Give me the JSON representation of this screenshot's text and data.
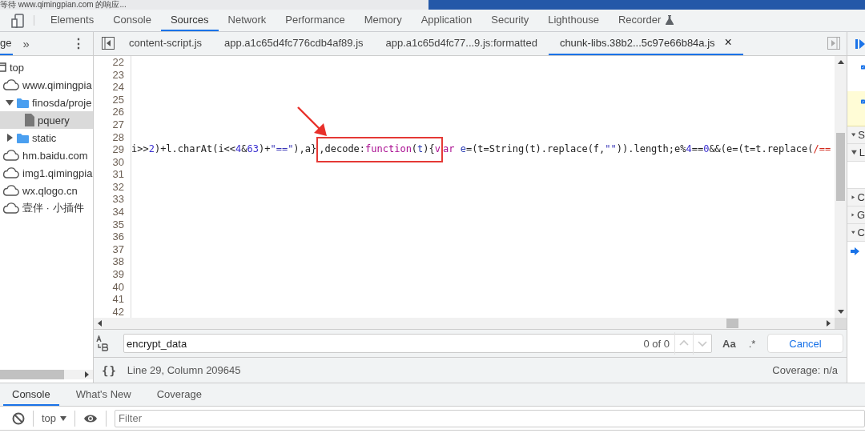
{
  "browser_status": "等待 www.qimingpian.com 的响应...",
  "main_tabs": [
    {
      "label": "Elements",
      "selected": false,
      "experimental": false
    },
    {
      "label": "Console",
      "selected": false,
      "experimental": false
    },
    {
      "label": "Sources",
      "selected": true,
      "experimental": false
    },
    {
      "label": "Network",
      "selected": false,
      "experimental": false
    },
    {
      "label": "Performance",
      "selected": false,
      "experimental": false
    },
    {
      "label": "Memory",
      "selected": false,
      "experimental": false
    },
    {
      "label": "Application",
      "selected": false,
      "experimental": false
    },
    {
      "label": "Security",
      "selected": false,
      "experimental": false
    },
    {
      "label": "Lighthouse",
      "selected": false,
      "experimental": false
    },
    {
      "label": "Recorder",
      "selected": false,
      "experimental": true
    }
  ],
  "navigator": {
    "tabs": [
      {
        "label": "ge",
        "selected": true
      }
    ],
    "more": "»",
    "menu": "⋮",
    "tree": [
      {
        "label": "top",
        "kind": "frame",
        "selected": false,
        "children": [
          {
            "label": "www.qimingpia",
            "kind": "domain",
            "selected": false,
            "children": [
              {
                "label": "finosda/proje",
                "kind": "folder",
                "expanded": true,
                "selected": false,
                "children": [
                  {
                    "label": "pquery",
                    "kind": "file",
                    "selected": true
                  }
                ]
              },
              {
                "label": "static",
                "kind": "folder",
                "expanded": false,
                "selected": false
              }
            ]
          },
          {
            "label": "hm.baidu.com",
            "kind": "domain",
            "selected": false
          },
          {
            "label": "img1.qimingpia",
            "kind": "domain",
            "selected": false
          },
          {
            "label": "wx.qlogo.cn",
            "kind": "domain",
            "selected": false
          },
          {
            "label": "壹伴 · 小插件",
            "kind": "domain",
            "selected": false
          }
        ]
      }
    ]
  },
  "editor": {
    "tabs": [
      {
        "label": "content-script.js",
        "selected": false
      },
      {
        "label": "app.a1c65d4fc776cdb4af89.js",
        "selected": false
      },
      {
        "label": "app.a1c65d4fc77...9.js:formatted",
        "selected": false
      },
      {
        "label": "chunk-libs.38b2...5c97e66b84a.js",
        "selected": true,
        "close_label": "×"
      }
    ],
    "lines": [
      {
        "number": "22"
      },
      {
        "number": "23"
      },
      {
        "number": "24"
      },
      {
        "number": "25"
      },
      {
        "number": "26"
      },
      {
        "number": "27"
      },
      {
        "number": "28"
      },
      {
        "number": "29",
        "tokens": [
          {
            "text": "i>>",
            "kind": "plain"
          },
          {
            "text": "2",
            "kind": "number"
          },
          {
            "text": ")+l.charAt(i<<",
            "kind": "plain"
          },
          {
            "text": "4",
            "kind": "number"
          },
          {
            "text": "&",
            "kind": "plain"
          },
          {
            "text": "63",
            "kind": "number"
          },
          {
            "text": ")+",
            "kind": "plain"
          },
          {
            "text": "\"==\"",
            "kind": "string"
          },
          {
            "text": "),a}",
            "kind": "plain"
          },
          {
            "text": ",decode:",
            "kind": "plain",
            "boxed": true
          },
          {
            "text": "function",
            "kind": "keyword",
            "boxed": true
          },
          {
            "text": "(",
            "kind": "plain",
            "boxed": true
          },
          {
            "text": "t",
            "kind": "def",
            "boxed": true
          },
          {
            "text": "){",
            "kind": "plain",
            "boxed": true
          },
          {
            "text": "v",
            "kind": "keyword",
            "boxed": true
          },
          {
            "text": "ar",
            "kind": "keyword"
          },
          {
            "text": " e",
            "kind": "def"
          },
          {
            "text": "=(t=String(t).replace(f,",
            "kind": "plain"
          },
          {
            "text": "\"\"",
            "kind": "string"
          },
          {
            "text": ")).length;e%",
            "kind": "plain"
          },
          {
            "text": "4",
            "kind": "number"
          },
          {
            "text": "==",
            "kind": "plain"
          },
          {
            "text": "0",
            "kind": "number"
          },
          {
            "text": "&&(e=(t=t.replace(",
            "kind": "plain"
          },
          {
            "text": "/==",
            "kind": "regex"
          }
        ]
      },
      {
        "number": "30"
      },
      {
        "number": "31"
      },
      {
        "number": "32"
      },
      {
        "number": "33"
      },
      {
        "number": "34"
      },
      {
        "number": "35"
      },
      {
        "number": "36"
      },
      {
        "number": "37"
      },
      {
        "number": "38"
      },
      {
        "number": "39"
      },
      {
        "number": "40"
      },
      {
        "number": "41"
      },
      {
        "number": "42"
      }
    ]
  },
  "search": {
    "query": "encrypt_data",
    "match_count": "0 of 0",
    "case_label": "Aa",
    "regex_label": ".*",
    "cancel": "Cancel"
  },
  "status_bar": {
    "format_label": "{}",
    "position": "Line 29, Column 209645",
    "coverage": "Coverage: n/a"
  },
  "right_panel": {
    "rows": [
      {
        "kind": "checkbox",
        "checked": true,
        "highlighted": false
      },
      {
        "kind": "checkbox",
        "checked": true,
        "highlighted": true
      },
      {
        "kind": "section",
        "label": "S",
        "expanded": true
      },
      {
        "kind": "section",
        "label": "L",
        "expanded": true
      },
      {
        "kind": "section",
        "label": "C",
        "expanded": false
      },
      {
        "kind": "section",
        "label": "G",
        "expanded": false
      },
      {
        "kind": "section",
        "label": "C",
        "expanded": true
      },
      {
        "kind": "pointer"
      }
    ]
  },
  "drawer": {
    "tabs": [
      {
        "label": "Console",
        "selected": true
      },
      {
        "label": "What's New",
        "selected": false
      },
      {
        "label": "Coverage",
        "selected": false
      }
    ],
    "context": "top",
    "filter_placeholder": "Filter"
  }
}
